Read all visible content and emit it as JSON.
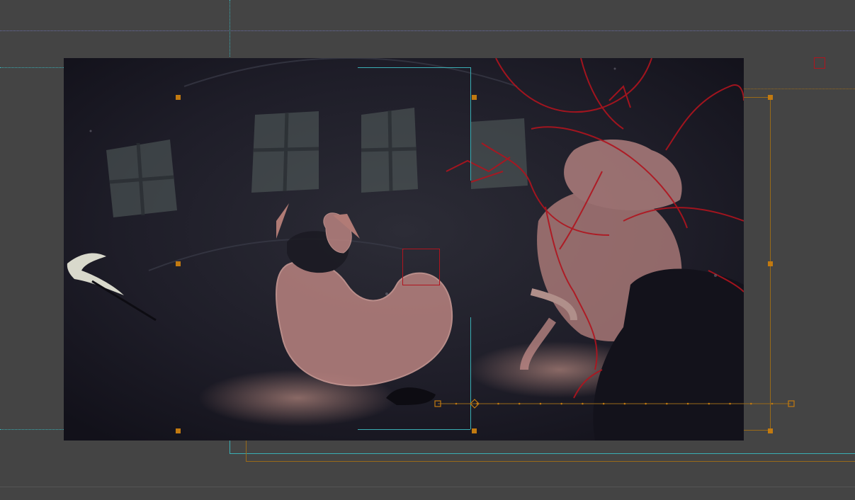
{
  "canvas": {
    "background_color": "#444444",
    "guide_color_cyan": "#3aaeb4",
    "guide_color_blue": "#6a6ea8",
    "guide_color_orange": "#9a6a18",
    "handle_color": "#c27a10",
    "sketch_color": "#b0141e",
    "character_fill": "#b98380"
  },
  "viewer": {
    "icons": [
      "corner-marker-icon",
      "anchor-pivot-icon",
      "end-marker-icon",
      "start-marker-icon",
      "scythe-prop-icon"
    ],
    "motion_path_dots": 16
  }
}
